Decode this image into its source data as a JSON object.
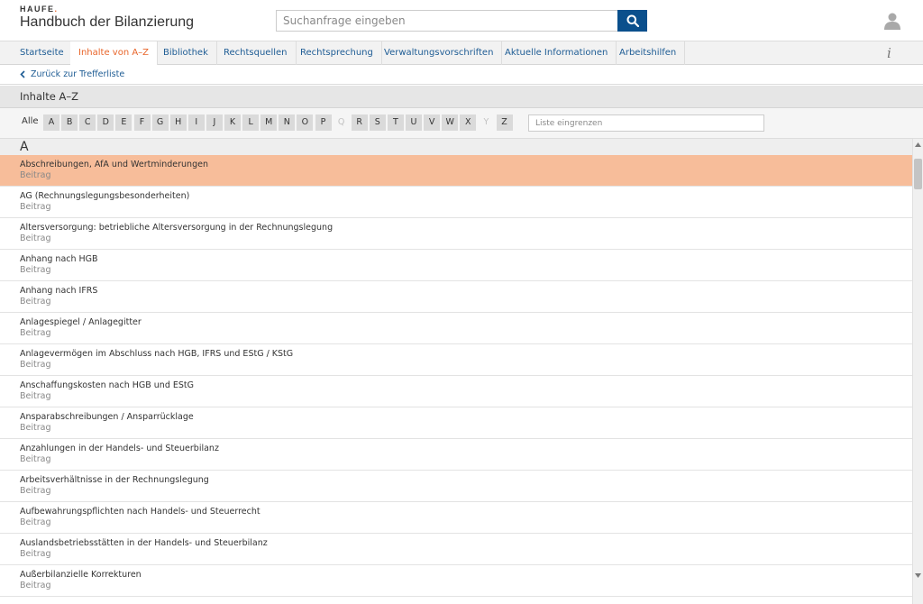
{
  "header": {
    "logo_text": "HAUFE",
    "logo_dot": ".",
    "app_title": "Handbuch der Bilanzierung",
    "search_placeholder": "Suchanfrage eingeben",
    "search_icon": "search-icon",
    "user_icon": "user-icon"
  },
  "nav": {
    "items": [
      "Startseite",
      "Inhalte von A–Z",
      "Bibliothek",
      "Rechtsquellen",
      "Rechtsprechung",
      "Verwaltungsvorschriften",
      "Aktuelle Informationen",
      "Arbeitshilfen"
    ],
    "active_index": 1,
    "info_label": "i"
  },
  "back_link": "Zurück zur Trefferliste",
  "section_title": "Inhalte A–Z",
  "alphabet": {
    "all_label": "Alle",
    "letters": [
      "A",
      "B",
      "C",
      "D",
      "E",
      "F",
      "G",
      "H",
      "I",
      "J",
      "K",
      "L",
      "M",
      "N",
      "O",
      "P",
      "Q",
      "R",
      "S",
      "T",
      "U",
      "V",
      "W",
      "X",
      "Y",
      "Z"
    ],
    "disabled": [
      "Q",
      "Y"
    ],
    "filter_placeholder": "Liste eingrenzen"
  },
  "list": {
    "group_letter": "A",
    "selected_index": 0,
    "items": [
      {
        "title": "Abschreibungen, AfA und Wertminderungen",
        "type": "Beitrag"
      },
      {
        "title": "AG (Rechnungslegungsbesonderheiten)",
        "type": "Beitrag"
      },
      {
        "title": "Altersversorgung: betriebliche Altersversorgung in der Rechnungslegung",
        "type": "Beitrag"
      },
      {
        "title": "Anhang nach HGB",
        "type": "Beitrag"
      },
      {
        "title": "Anhang nach IFRS",
        "type": "Beitrag"
      },
      {
        "title": "Anlagespiegel / Anlagegitter",
        "type": "Beitrag"
      },
      {
        "title": "Anlagevermögen im Abschluss nach HGB, IFRS und EStG / KStG",
        "type": "Beitrag"
      },
      {
        "title": "Anschaffungskosten nach HGB und EStG",
        "type": "Beitrag"
      },
      {
        "title": "Ansparabschreibungen / Ansparrücklage",
        "type": "Beitrag"
      },
      {
        "title": "Anzahlungen in der Handels- und Steuerbilanz",
        "type": "Beitrag"
      },
      {
        "title": "Arbeitsverhältnisse in der Rechnungslegung",
        "type": "Beitrag"
      },
      {
        "title": "Aufbewahrungspflichten nach Handels- und Steuerrecht",
        "type": "Beitrag"
      },
      {
        "title": "Auslandsbetriebsstätten in der Handels- und Steuerbilanz",
        "type": "Beitrag"
      },
      {
        "title": "Außerbilanzielle Korrekturen",
        "type": "Beitrag"
      }
    ]
  },
  "colors": {
    "accent": "#e8652a",
    "link": "#1e5c94",
    "search_button": "#0a4f8c",
    "selected_row": "#f7bd9a"
  }
}
